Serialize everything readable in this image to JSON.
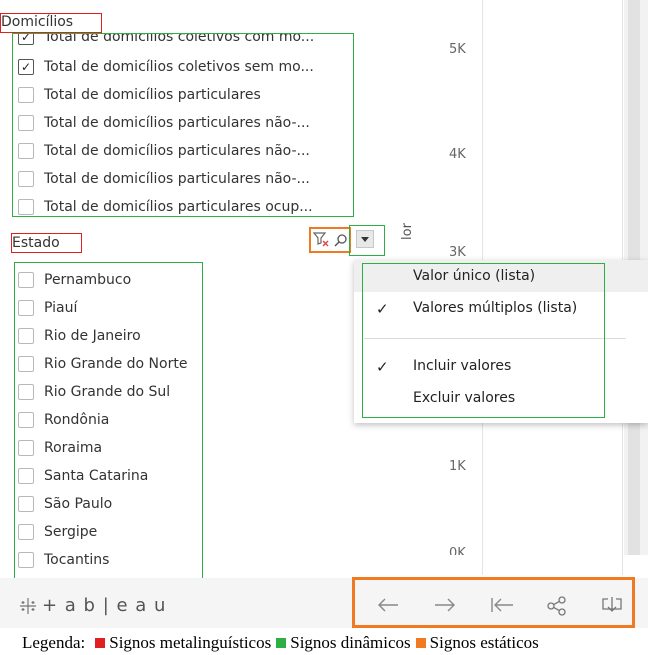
{
  "domicilios": {
    "header": "Domicílios",
    "items": [
      {
        "label": "Total de domicílios coletivos com mo...",
        "checked": true
      },
      {
        "label": "Total de domicílios coletivos sem mo...",
        "checked": true
      },
      {
        "label": "Total de domicílios particulares",
        "checked": false
      },
      {
        "label": "Total de domicílios particulares não-...",
        "checked": false
      },
      {
        "label": "Total de domicílios particulares não-...",
        "checked": false
      },
      {
        "label": "Total de domicílios particulares não-...",
        "checked": false
      },
      {
        "label": "Total de domicílios particulares ocup...",
        "checked": false
      }
    ]
  },
  "estado": {
    "header": "Estado",
    "items": [
      "Pernambuco",
      "Piauí",
      "Rio de Janeiro",
      "Rio Grande do Norte",
      "Rio Grande do Sul",
      "Rondônia",
      "Roraima",
      "Santa Catarina",
      "São Paulo",
      "Sergipe",
      "Tocantins"
    ]
  },
  "axis": {
    "title": "lor",
    "ticks": [
      "5K",
      "4K",
      "3K",
      "1K",
      "0K"
    ]
  },
  "menu": {
    "single": "Valor único (lista)",
    "multiple": "Valores múltiplos (lista)",
    "include": "Incluir valores",
    "exclude": "Excluir valores",
    "check": "✓"
  },
  "footer": {
    "logo": "+ a b | e a u",
    "icons": [
      "undo-icon",
      "redo-icon",
      "revert-icon",
      "share-icon",
      "download-icon"
    ]
  },
  "legend": {
    "prefix": "Legenda:",
    "items": [
      {
        "label": "Signos metalinguísticos",
        "color": "#e02020"
      },
      {
        "label": "Signos dinâmicos",
        "color": "#2fae44"
      },
      {
        "label": "Signos estáticos",
        "color": "#f07a22"
      }
    ]
  }
}
